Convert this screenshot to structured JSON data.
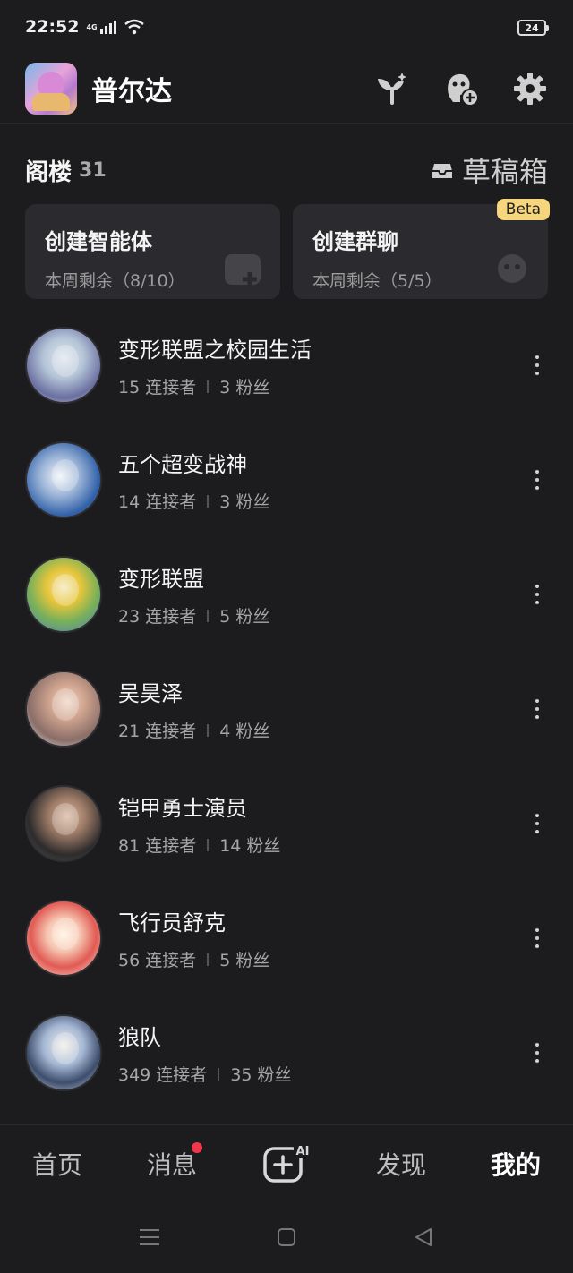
{
  "status": {
    "time": "22:52",
    "network": "4G",
    "battery": "24"
  },
  "header": {
    "name": "普尔达"
  },
  "section": {
    "title": "阁楼",
    "count": "31",
    "drafts_label": "草稿箱"
  },
  "cards": [
    {
      "title": "创建智能体",
      "subtitle": "本周剩余（8/10）"
    },
    {
      "title": "创建群聊",
      "subtitle": "本周剩余（5/5）",
      "badge": "Beta"
    }
  ],
  "agents": [
    {
      "name": "变形联盟之校园生活",
      "connectors": "15 连接者",
      "fans": "3 粉丝"
    },
    {
      "name": "五个超变战神",
      "connectors": "14 连接者",
      "fans": "3 粉丝"
    },
    {
      "name": "变形联盟",
      "connectors": "23 连接者",
      "fans": "5 粉丝"
    },
    {
      "name": "吴昊泽",
      "connectors": "21 连接者",
      "fans": "4 粉丝"
    },
    {
      "name": "铠甲勇士演员",
      "connectors": "81 连接者",
      "fans": "14 粉丝"
    },
    {
      "name": "飞行员舒克",
      "connectors": "56 连接者",
      "fans": "5 粉丝"
    },
    {
      "name": "狼队",
      "connectors": "349 连接者",
      "fans": "35 粉丝"
    }
  ],
  "tabs": {
    "home": "首页",
    "messages": "消息",
    "create_ai": "AI",
    "discover": "发现",
    "mine": "我的"
  },
  "colors": {
    "background": "#1c1c1e",
    "card": "#2b2b2f",
    "badge": "#f7d57c",
    "notification_dot": "#f0384b"
  },
  "icons": {
    "header": [
      "sprout-sparkle-icon",
      "add-character-icon",
      "gear-icon"
    ],
    "drafts": "drafts-box-icon",
    "agent_more": "more-vertical-icon",
    "nav": [
      "menu-icon",
      "home-square-icon",
      "back-triangle-icon"
    ]
  }
}
